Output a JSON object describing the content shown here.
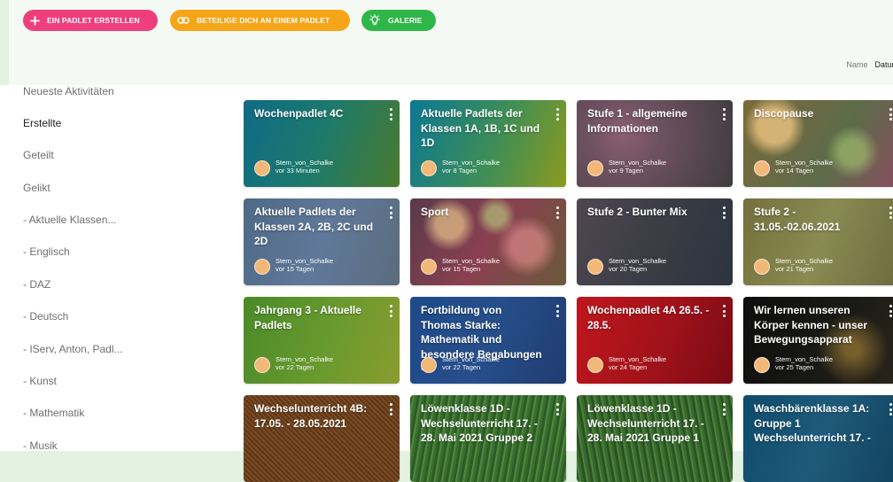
{
  "header": {
    "buttons": {
      "create": "EIN PADLET ERSTELLEN",
      "join": "BETEILIGE DICH AN EINEM PADLET",
      "gallery": "GALERIE"
    },
    "sort": {
      "name": "Name",
      "date": "Datum"
    }
  },
  "sidebar": {
    "items": [
      "Neueste Aktivitäten",
      "Erstellte",
      "Geteilt",
      "Gelikt",
      "- Aktuelle Klassen...",
      "- Englisch",
      "- DAZ",
      "- Deutsch",
      "- IServ, Anton, Padl...",
      "- Kunst",
      "- Mathematik",
      "- Musik"
    ],
    "active_index": 1
  },
  "padlets": [
    {
      "title": "Wochenpadlet 4C",
      "author": "Stern_von_Schalke",
      "time": "vor 33 Minuten"
    },
    {
      "title": "Aktuelle Padlets der Klassen 1A, 1B, 1C und 1D",
      "author": "Stern_von_Schalke",
      "time": "vor 8 Tagen"
    },
    {
      "title": "Stufe 1 - allgemeine Informationen",
      "author": "Stern_von_Schalke",
      "time": "vor 9 Tagen"
    },
    {
      "title": "Discopause",
      "author": "Stern_von_Schalke",
      "time": "vor 14 Tagen"
    },
    {
      "title": "Aktuelle Padlets der Klassen 2A, 2B, 2C und 2D",
      "author": "Stern_von_Schalke",
      "time": "vor 15 Tagen"
    },
    {
      "title": "Sport",
      "author": "Stern_von_Schalke",
      "time": "vor 15 Tagen"
    },
    {
      "title": "Stufe 2 - Bunter Mix",
      "author": "Stern_von_Schalke",
      "time": "vor 20 Tagen"
    },
    {
      "title": "Stufe 2 - 31.05.-02.06.2021",
      "author": "Stern_von_Schalke",
      "time": "vor 21 Tagen"
    },
    {
      "title": "Jahrgang 3 - Aktuelle Padlets",
      "author": "Stern_von_Schalke",
      "time": "vor 22 Tagen"
    },
    {
      "title": "Fortbildung von Thomas Starke: Mathematik und besondere Begabungen -",
      "author": "Stern_von_Schalke",
      "time": "vor 22 Tagen"
    },
    {
      "title": "Wochenpadlet 4A 26.5. - 28.5.",
      "author": "Stern_von_Schalke",
      "time": "vor 24 Tagen"
    },
    {
      "title": "Wir lernen unseren Körper kennen - unser Bewegungsapparat",
      "author": "Stern_von_Schalke",
      "time": "vor 25 Tagen"
    },
    {
      "title": "Wechselunterricht 4B: 17.05. - 28.05.2021",
      "author": "",
      "time": ""
    },
    {
      "title": "Löwenklasse 1D - Wechselunterricht 17. - 28. Mai 2021 Gruppe 2",
      "author": "",
      "time": ""
    },
    {
      "title": "Löwenklasse 1D - Wechselunterricht 17. - 28. Mai 2021 Gruppe 1",
      "author": "",
      "time": ""
    },
    {
      "title": "Waschbärenklasse 1A: Gruppe 1 Wechselunterricht 17. -",
      "author": "",
      "time": ""
    }
  ],
  "colors": {
    "create": "#ee3f7c",
    "join": "#f5a517",
    "gallery": "#2fb649"
  }
}
